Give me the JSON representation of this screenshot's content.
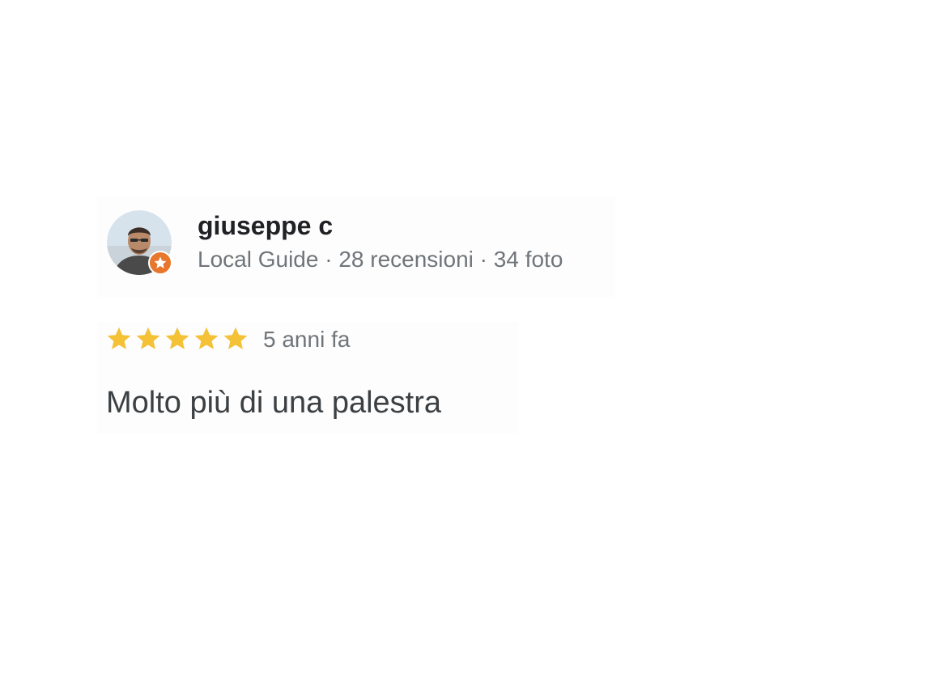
{
  "review": {
    "author": {
      "name": "giuseppe c",
      "level": "Local Guide",
      "separator": "·",
      "reviews_count": "28 recensioni",
      "photos_count": "34 foto",
      "avatar_icon": "person-avatar",
      "badge_icon": "local-guide-star-badge",
      "badge_color": "#e8772e"
    },
    "rating": 5,
    "rating_max": 5,
    "star_color": "#f4c137",
    "time_ago": "5 anni fa",
    "text": "Molto più di una palestra"
  }
}
